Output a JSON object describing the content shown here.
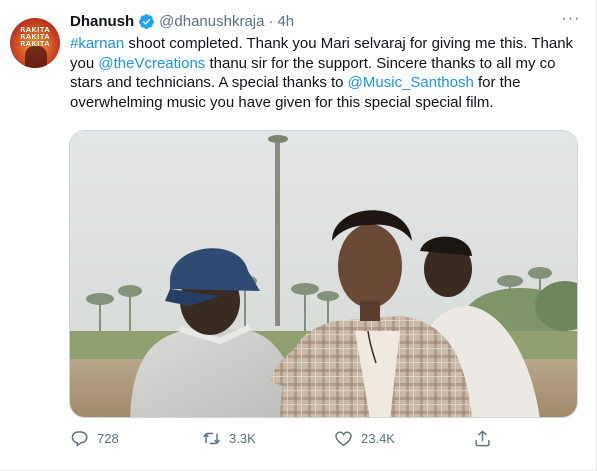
{
  "tweet": {
    "author_name": "Dhanush",
    "handle": "@dhanushkraja",
    "separator": "·",
    "time": "4h",
    "more_label": "···",
    "avatar": {
      "icon": "movie-poster-avatar",
      "poster_lines": [
        "RAKITA",
        "RAKITA",
        "RAKITA"
      ]
    },
    "text": {
      "hashtag": "#karnan",
      "part1": " shoot completed. Thank you Mari selvaraj for giving me this. Thank you ",
      "mention1": "@theVcreations",
      "part2": " thanu sir for the support. Sincere thanks to all my co stars and technicians. A special thanks to ",
      "mention2": "@Music_Santhosh",
      "part3": " for the overwhelming music you have given for this special special film."
    },
    "media": {
      "description_icon": "photo"
    },
    "actions": {
      "reply_count": "728",
      "retweet_count": "3.3K",
      "like_count": "23.4K"
    }
  },
  "colors": {
    "link": "#1b95e0",
    "secondary": "#5b7083",
    "verified": "#1da1f2",
    "text": "#0f1419"
  },
  "icons": [
    "verified-badge-icon",
    "more-icon",
    "reply-icon",
    "retweet-icon",
    "like-icon",
    "share-icon"
  ]
}
